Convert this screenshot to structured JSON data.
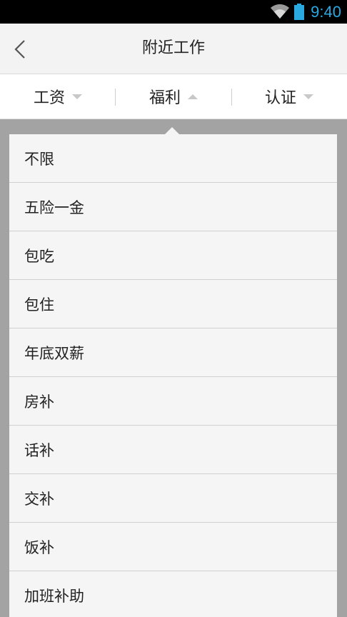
{
  "status_bar": {
    "time": "9:40",
    "icons": [
      "wifi-icon",
      "battery-icon"
    ],
    "time_color": "#2aa8e0"
  },
  "header": {
    "title": "附近工作",
    "back_icon": "chevron-left-icon"
  },
  "filters": [
    {
      "label": "工资",
      "arrow": "down"
    },
    {
      "label": "福利",
      "arrow": "up",
      "active": true
    },
    {
      "label": "认证",
      "arrow": "down"
    }
  ],
  "dropdown": {
    "options": [
      "不限",
      "五险一金",
      "包吃",
      "包住",
      "年底双薪",
      "房补",
      "话补",
      "交补",
      "饭补",
      "加班补助"
    ]
  }
}
